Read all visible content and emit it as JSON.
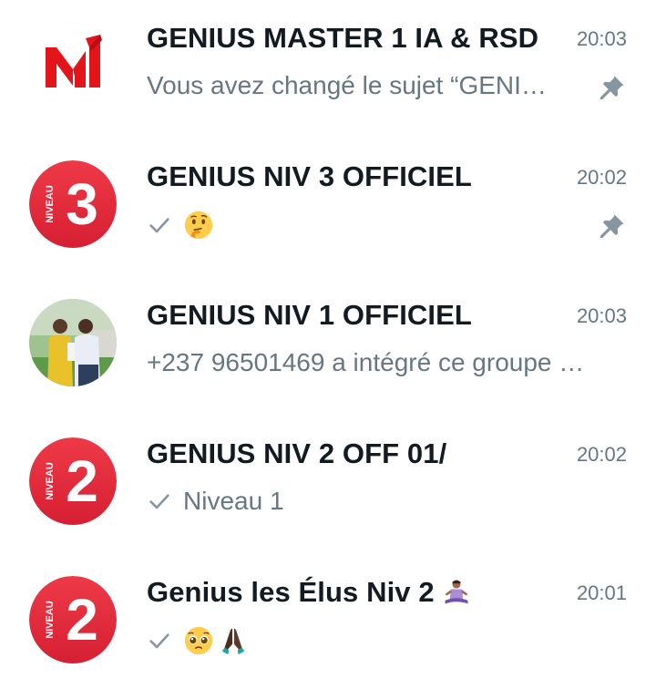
{
  "chats": [
    {
      "title": "GENIUS MASTER 1 IA & RSD",
      "time": "20:03",
      "preview": "Vous avez changé le sujet “GENI…",
      "pinned": true,
      "avatar": "master-logo-icon"
    },
    {
      "title": "GENIUS NIV 3 OFFICIEL",
      "time": "20:02",
      "preview": "",
      "pinned": true,
      "avatar": "niveau-3-badge-icon",
      "avatar_text": "NIVEAU",
      "avatar_number": "3"
    },
    {
      "title": "GENIUS NIV 1 OFFICIEL",
      "time": "20:03",
      "preview": "+237 96501469 a intégré ce groupe …",
      "pinned": false,
      "avatar": "group-photo"
    },
    {
      "title": "GENIUS NIV 2 OFF 01/",
      "time": "20:02",
      "preview": "Niveau 1",
      "pinned": false,
      "avatar": "niveau-2-badge-icon",
      "avatar_text": "NIVEAU",
      "avatar_number": "2"
    },
    {
      "title": "Genius les Élus Niv 2",
      "time": "20:01",
      "preview": "",
      "pinned": false,
      "avatar": "niveau-2-badge-icon",
      "avatar_text": "NIVEAU",
      "avatar_number": "2"
    }
  ],
  "colors": {
    "badge_red": "#e5283a",
    "logo_red": "#e3151b",
    "title": "#111b21",
    "secondary": "#667781"
  }
}
